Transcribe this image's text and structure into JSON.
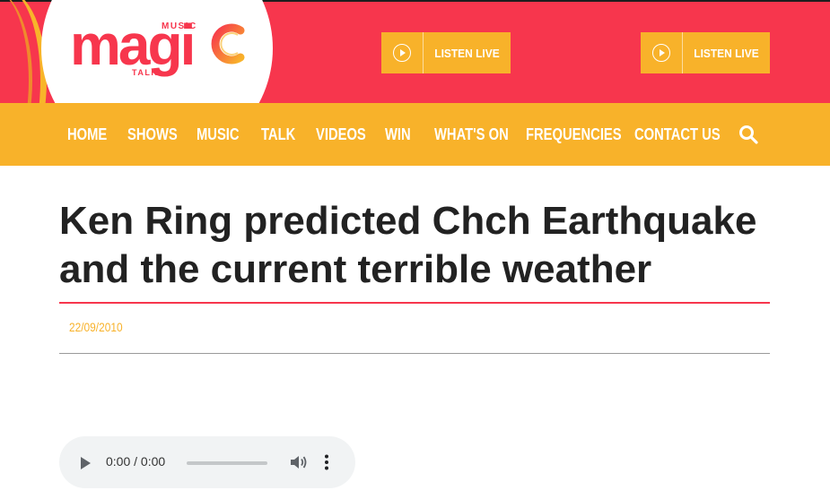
{
  "header": {
    "logo": {
      "word": "magi",
      "top_label": "MUSIC",
      "bottom_label": "TALK",
      "letter_c": "C"
    },
    "listen_buttons": [
      {
        "label": "LISTEN LIVE",
        "icon": "play-circle-icon"
      },
      {
        "label": "LISTEN LIVE",
        "icon": "play-circle-icon"
      }
    ],
    "colors": {
      "brand_red": "#f7364d",
      "accent_yellow": "#f8b22a"
    }
  },
  "nav": {
    "items": [
      "HOME",
      "SHOWS",
      "MUSIC",
      "TALK",
      "VIDEOS",
      "WIN",
      "WHAT'S ON",
      "FREQUENCIES",
      "CONTACT US"
    ],
    "search_icon": "search-icon"
  },
  "article": {
    "title": "Ken Ring predicted Chch Earthquake and the current terrible weather",
    "date": "22/09/2010"
  },
  "audio_player": {
    "time": "0:00 / 0:00",
    "icons": [
      "play-icon",
      "volume-icon",
      "more-vert-icon"
    ]
  }
}
